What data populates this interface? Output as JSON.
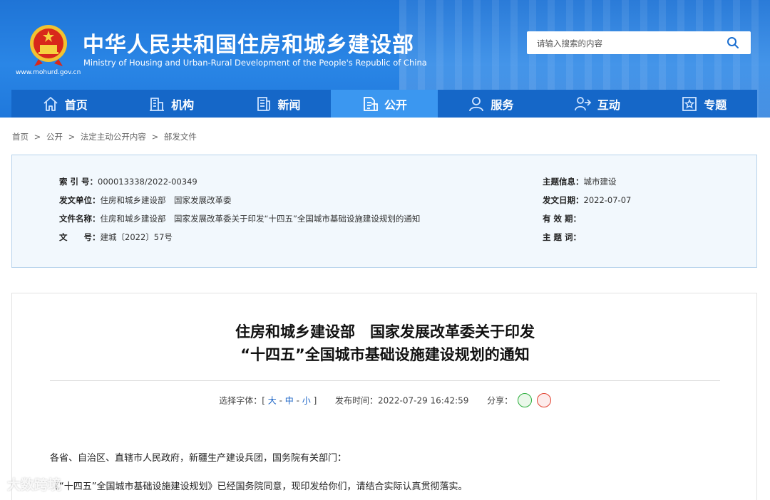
{
  "header": {
    "site_title": "中华人民共和国住房和城乡建设部",
    "site_subtitle": "Ministry of Housing and Urban-Rural Development of the People's Republic of China",
    "site_url": "www.mohurd.gov.cn",
    "search_placeholder": "请输入搜索的内容",
    "brand_color": "#1f74d6"
  },
  "nav": [
    {
      "label": "首页",
      "icon": "home-icon"
    },
    {
      "label": "机构",
      "icon": "building-icon"
    },
    {
      "label": "新闻",
      "icon": "news-icon"
    },
    {
      "label": "公开",
      "icon": "document-icon",
      "active": true
    },
    {
      "label": "服务",
      "icon": "user-service-icon"
    },
    {
      "label": "互动",
      "icon": "interaction-icon"
    },
    {
      "label": "专题",
      "icon": "star-icon"
    }
  ],
  "breadcrumb": [
    "首页",
    ">",
    "公开",
    ">",
    "法定主动公开内容",
    ">",
    "部发文件"
  ],
  "meta": {
    "index_no_label": "索 引 号：",
    "index_no": "000013338/2022-00349",
    "issuer_label": "发文单位：",
    "issuer": "住房和城乡建设部　国家发展改革委",
    "doc_name_label": "文件名称：",
    "doc_name": "住房和城乡建设部　国家发展改革委关于印发“十四五”全国城市基础设施建设规划的通知",
    "doc_no_label": "文　　号：",
    "doc_no": "建城〔2022〕57号",
    "topic_label": "主题信息：",
    "topic": "城市建设",
    "date_label": "发文日期：",
    "date": "2022-07-07",
    "validity_label": "有 效 期：",
    "validity": "",
    "keywords_label": "主 题 词：",
    "keywords": ""
  },
  "article": {
    "title_line1": "住房和城乡建设部　国家发展改革委关于印发",
    "title_line2": "“十四五”全国城市基础设施建设规划的通知",
    "font_label": "选择字体：[",
    "font_large": "大",
    "font_medium": "中",
    "font_small": "小",
    "font_sep": "-",
    "font_close": "]",
    "publish_label": "发布时间：",
    "publish_time": "2022-07-29 16:42:59",
    "share_label": "分享：",
    "para1": "各省、自治区、直辖市人民政府，新疆生产建设兵团，国务院有关部门：",
    "para2": "《“十四五”全国城市基础设施建设规划》已经国务院同意，现印发给你们，请结合实际认真贯彻落实。"
  },
  "watermark": "大数跨境"
}
